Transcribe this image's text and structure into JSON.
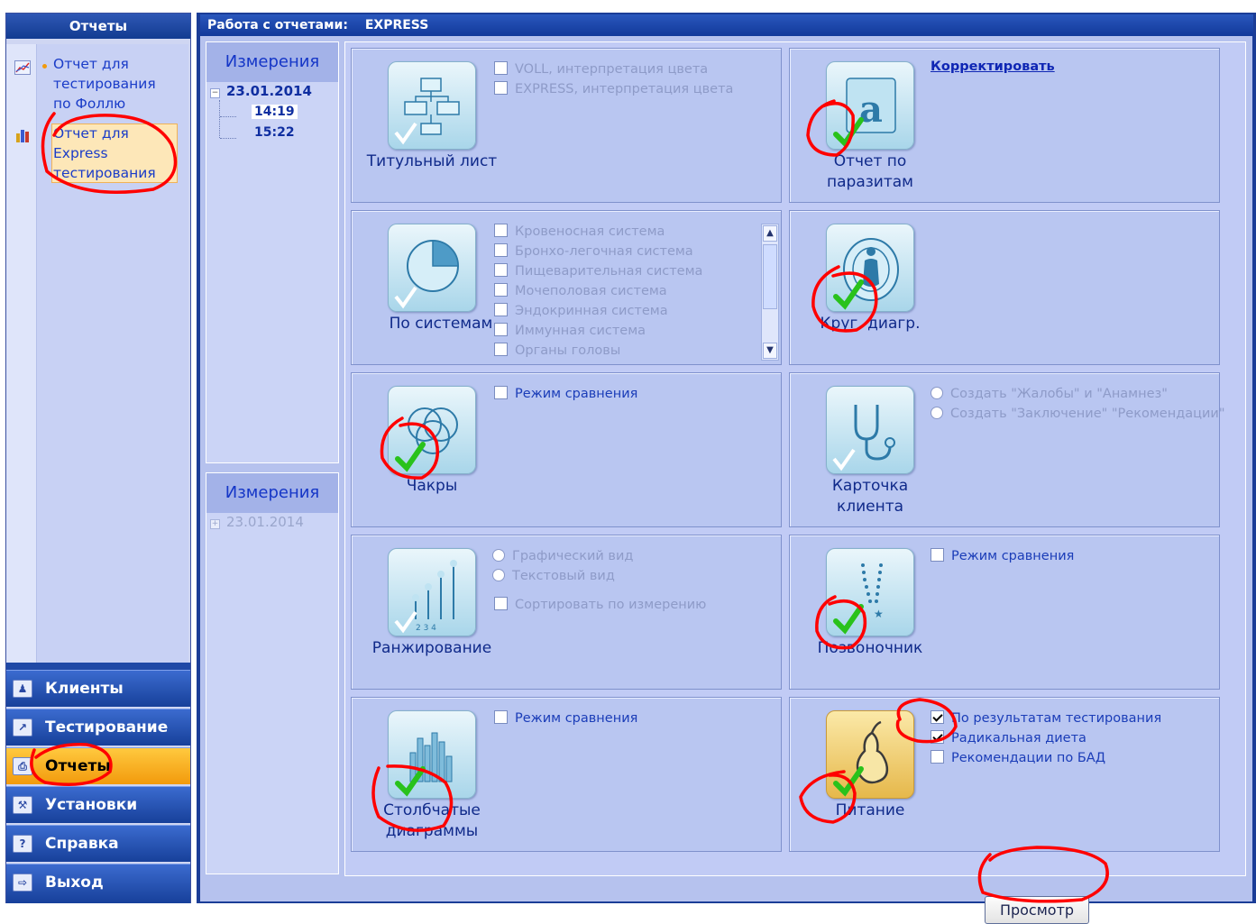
{
  "sidebar": {
    "title": "Отчеты",
    "reports": [
      {
        "label_lines": [
          "Отчет для",
          "тестирования",
          "по Фоллю"
        ],
        "icon": "chart-line-icon"
      },
      {
        "label_lines": [
          "Отчет для",
          "Express",
          "тестирования"
        ],
        "icon": "bar-chart-icon"
      }
    ],
    "nav": [
      {
        "label": "Клиенты",
        "icon": "clients-icon",
        "active": false
      },
      {
        "label": "Тестирование",
        "icon": "testing-icon",
        "active": false
      },
      {
        "label": "Отчеты",
        "icon": "reports-icon",
        "active": true
      },
      {
        "label": "Установки",
        "icon": "settings-icon",
        "active": false
      },
      {
        "label": "Справка",
        "icon": "help-icon",
        "active": false
      },
      {
        "label": "Выход",
        "icon": "exit-icon",
        "active": false
      }
    ]
  },
  "main": {
    "header_label": "Работа с отчетами:",
    "header_mode": "EXPRESS",
    "measurements": [
      {
        "title": "Измерения",
        "date": "23.01.2014",
        "times": [
          "14:19",
          "15:22"
        ]
      },
      {
        "title": "Измерения",
        "date": "23.01.2014",
        "times": []
      }
    ],
    "cards": {
      "title_page": {
        "label": "Титульный лист",
        "options": [
          "VOLL, интерпретация цвета",
          "EXPRESS, интерпретация цвета"
        ]
      },
      "parasites": {
        "label": "Отчет по паразитам",
        "link": "Корректировать"
      },
      "systems": {
        "label": "По системам",
        "options": [
          "Кровеносная система",
          "Бронхо-легочная система",
          "Пищеварительная система",
          "Мочеполовая система",
          "Эндокринная система",
          "Иммунная система",
          "Органы головы"
        ]
      },
      "circle": {
        "label": "Круг. диагр."
      },
      "chakras": {
        "label": "Чакры",
        "options": [
          "Режим сравнения"
        ]
      },
      "client_card": {
        "label": "Карточка клиента",
        "options": [
          "Создать \"Жалобы\" и \"Анамнез\"",
          "Создать \"Заключение\" \"Рекомендации\""
        ]
      },
      "ranking": {
        "label": "Ранжирование",
        "options": [
          "Графический вид",
          "Текстовый вид",
          "Сортировать по измерению"
        ]
      },
      "spine": {
        "label": "Позвоночник",
        "options": [
          "Режим сравнения"
        ]
      },
      "bar_charts": {
        "label": "Столбчатые диаграммы",
        "options": [
          "Режим сравнения"
        ]
      },
      "nutrition": {
        "label": "Питание",
        "options": [
          "По результатам тестирования",
          "Радикальная диета",
          "Рекомендации по БАД"
        ],
        "checked": [
          true,
          true,
          false
        ]
      }
    },
    "view_button": "Просмотр"
  },
  "colors": {
    "accent": "#1b3d97",
    "annotation_red": "#ff0000",
    "check_green": "#29c21b",
    "active_nav": "#f5a31a"
  }
}
